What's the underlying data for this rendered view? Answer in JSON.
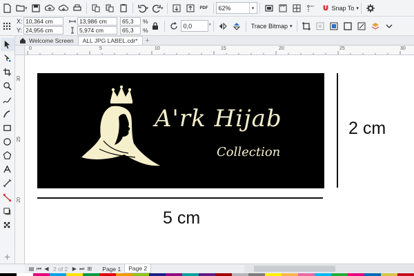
{
  "toolbar": {
    "zoom_value": "62%",
    "snap_label": "Snap To",
    "pdf_label": "PDF"
  },
  "property_bar": {
    "x_label": "X:",
    "x_value": "10,364 cm",
    "y_label": "Y:",
    "y_value": "24,956 cm",
    "width_value": "13,986 cm",
    "height_value": "5,974 cm",
    "scale_x": "65,3",
    "scale_y": "65,3",
    "pct_symbol": "%",
    "rotation_value": "0,0",
    "trace_bitmap_label": "Trace Bitmap"
  },
  "tabs": [
    {
      "label": "Welcome Screen",
      "active": false
    },
    {
      "label": "ALL JPG LABEL.cdr*",
      "active": true
    }
  ],
  "ruler": {
    "h_marks": [
      "0",
      "5",
      "10",
      "15",
      "20",
      "25",
      "30"
    ],
    "v_marks": [
      "30",
      "25",
      "20"
    ]
  },
  "canvas": {
    "brand_name": "A'rk Hijab",
    "brand_sub": "Collection",
    "height_dim": "2 cm",
    "width_dim": "5 cm",
    "label_bg": "#000000",
    "brand_color": "#f5efcb"
  },
  "pages": {
    "counter": "2  of  2",
    "page1": "Page 1",
    "page2": "Page 2"
  },
  "palette": [
    "#000000",
    "#ffffff",
    "#e6007e",
    "#00a0e9",
    "#ffe100",
    "#009944",
    "#e60012",
    "#f39800",
    "#8fc31f",
    "#1d2088",
    "#920783",
    "#00a29a",
    "#601986",
    "#a40000",
    "#b5b5b6",
    "#7d7d7d",
    "#fff100",
    "#f8b551",
    "#ea68a2",
    "#00b7ee",
    "#22ac38",
    "#e4007f",
    "#0068b7",
    "#d7c447",
    "#c30d23"
  ]
}
